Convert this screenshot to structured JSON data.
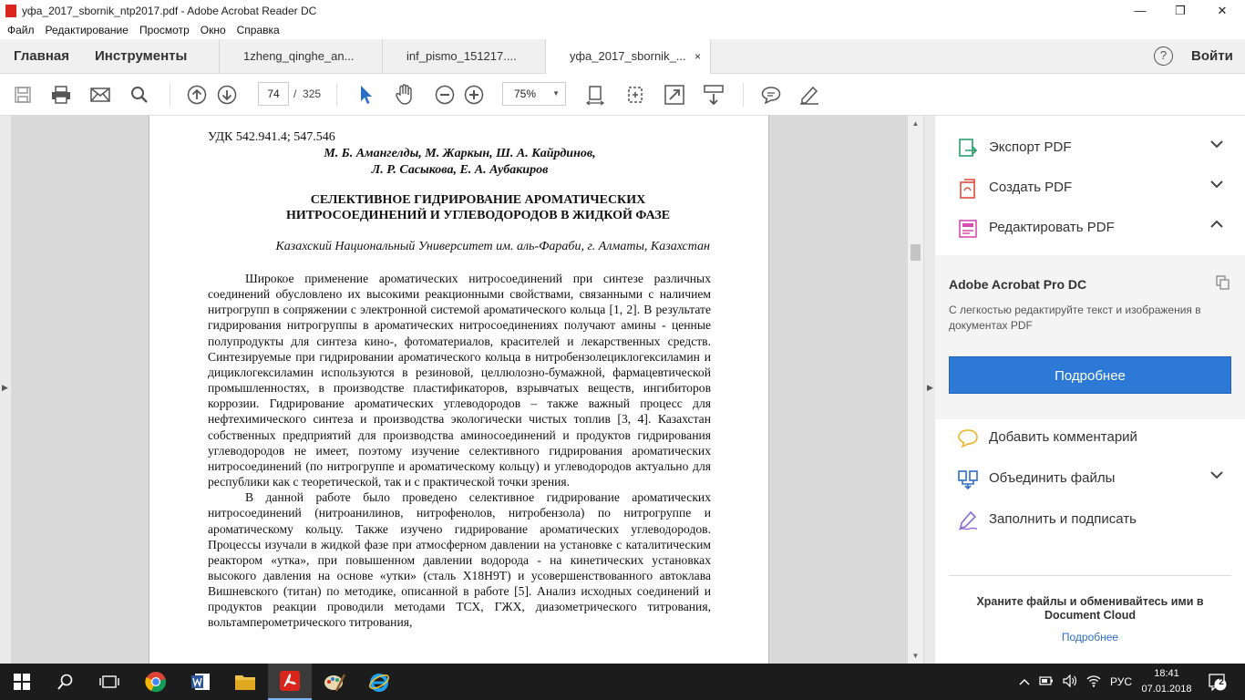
{
  "window": {
    "title": "уфа_2017_sbornik_ntp2017.pdf - Adobe Acrobat Reader DC",
    "minimize": "—",
    "maximize": "❐",
    "close": "✕"
  },
  "menu": [
    "Файл",
    "Редактирование",
    "Просмотр",
    "Окно",
    "Справка"
  ],
  "tabs": {
    "home": "Главная",
    "tools": "Инструменты",
    "docs": [
      {
        "label": "1zheng_qinghe_an..."
      },
      {
        "label": "inf_pismo_151217...."
      },
      {
        "label": "уфа_2017_sbornik_..."
      }
    ],
    "close": "×",
    "login": "Войти",
    "help": "?"
  },
  "toolbar": {
    "page_current": "74",
    "page_sep": "/",
    "page_total": "325",
    "zoom": "75%"
  },
  "document": {
    "udk": "УДК 542.941.4; 547.546",
    "authors_line1": "М. Б. Амангелды, М. Жаркын, Ш. А. Кайрдинов,",
    "authors_line2": "Л. Р. Сасыкова, Е. А. Аубакиров",
    "title_line1": "СЕЛЕКТИВНОЕ ГИДРИРОВАНИЕ АРОМАТИЧЕСКИХ",
    "title_line2": "НИТРОСОЕДИНЕНИЙ И УГЛЕВОДОРОДОВ В ЖИДКОЙ ФАЗЕ",
    "affiliation": "Казахский Национальный Университет им. аль-Фараби, г. Алматы, Казахстан",
    "paragraph1": "Широкое применение ароматических нитросоединений при синтезе различных соединений обусловлено их высокими реакционными свойствами, связанными с наличием нитрогрупп в сопряжении с электронной системой ароматического кольца [1, 2]. В результате гидрирования нитрогруппы в ароматических нитросоединениях получают амины - ценные полупродукты для синтеза кино-, фотоматериалов, красителей и лекарственных средств. Синтезируемые при гидрировании ароматического кольца в нитробензолециклогексиламин и дициклогексиламин используются в резиновой, целлюлозно-бумажной, фармацевтической промышленностях, в производстве пластификаторов, взрывчатых веществ, ингибиторов коррозии. Гидрирование ароматических углеводородов – также важный процесс для нефтехимического синтеза и производства экологически чистых топлив [3, 4]. Казахстан собственных предприятий для производства аминосоединений и продуктов гидрирования углеводородов не имеет, поэтому изучение селективного гидрирования ароматических нитросоединений (по нитрогруппе и ароматическому кольцу) и углеводородов актуально для республики как с теоретической, так и с практической точки зрения.",
    "paragraph2": "В данной работе было проведено селективное гидрирование ароматических нитросоединений (нитроанилинов, нитрофенолов, нитробензола) по нитрогруппе и ароматическому кольцу. Также изучено гидрирование ароматических углеводородов. Процессы изучали в жидкой фазе при атмосферном давлении на установке с каталитическим реактором «утка», при повышенном давлении водорода - на кинетических установках высокого давления на основе «утки» (сталь Х18Н9Т) и усовершенствованного автоклава Вишневского (титан) по методике, описанной в работе [5]. Анализ исходных соединений и продуктов реакции проводили методами ТСХ, ГЖХ, диазометрического титрования, вольтамперометрического титрования,"
  },
  "right_panel": {
    "export": "Экспорт PDF",
    "create": "Создать PDF",
    "edit": "Редактировать PDF",
    "promo_title": "Adobe Acrobat Pro DC",
    "promo_desc": "С легкостью редактируйте текст и изображения в документах PDF",
    "promo_button": "Подробнее",
    "comment": "Добавить комментарий",
    "combine": "Объединить файлы",
    "fill": "Заполнить и подписать",
    "cloud_text": "Храните файлы и обменивайтесь ими в Document Cloud",
    "cloud_link": "Подробнее"
  },
  "taskbar": {
    "lang": "РУС",
    "time": "18:41",
    "date": "07.01.2018",
    "notifications": "2"
  },
  "colors": {
    "accent": "#2d7ad6",
    "taskbar": "#1c1c1c",
    "pdf_red": "#d9251c"
  }
}
